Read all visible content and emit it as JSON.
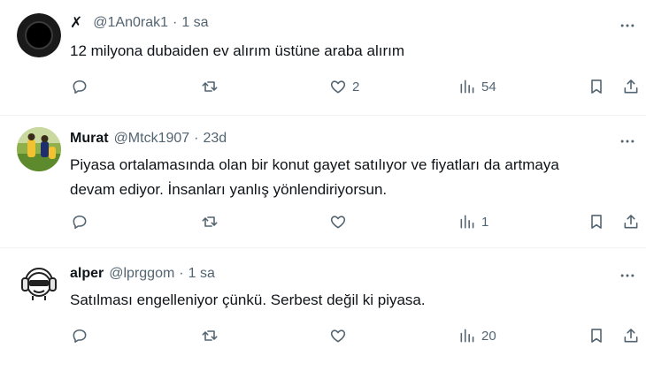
{
  "tweets": [
    {
      "avatar": "black-circle-avatar",
      "name": "",
      "name_icon": "x-icon",
      "handle": "@1An0rak1",
      "dot": "·",
      "time": "1 sa",
      "text": "12 milyona dubaiden ev alırım üstüne araba alırım",
      "likes": "2",
      "views": "54"
    },
    {
      "avatar": "photo-avatar",
      "name": "Murat",
      "handle": "@Mtck1907",
      "dot": "·",
      "time": "23d",
      "text_lines": [
        "Piyasa ortalamasında olan bir konut gayet satılıyor ve fiyatları da artmaya",
        "devam ediyor. İnsanları yanlış yönlendiriyorsun."
      ],
      "likes": "",
      "views": "1"
    },
    {
      "avatar": "cartoon-headphones-avatar",
      "name": "alper",
      "handle": "@lprggom",
      "dot": "·",
      "time": "1 sa",
      "text": "Satılması engelleniyor çünkü. Serbest değil ki piyasa.",
      "likes": "",
      "views": "20"
    }
  ],
  "colors": {
    "text": "#0f1419",
    "secondary": "#536471",
    "divider": "#eff3f4"
  }
}
